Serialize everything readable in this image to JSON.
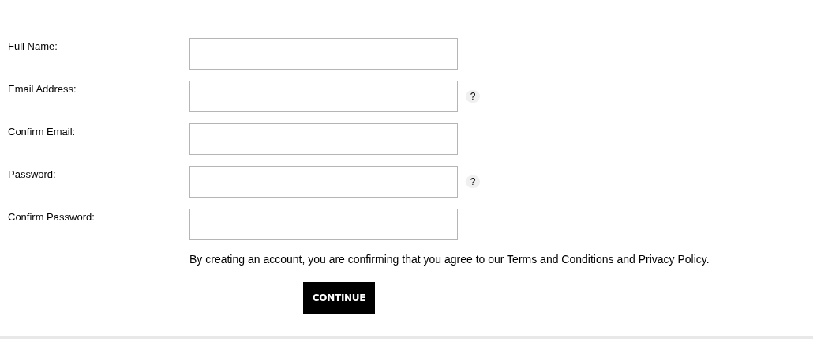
{
  "fields": [
    {
      "label": "Full Name:"
    },
    {
      "label": "Email Address:",
      "help": "?"
    },
    {
      "label": "Confirm Email:"
    },
    {
      "label": "Password:",
      "help": "?"
    },
    {
      "label": "Confirm Password:"
    }
  ],
  "agreement": "By creating an account, you are confirming that you agree to our Terms and Conditions and Privacy Policy.",
  "submit": "CONTINUE"
}
